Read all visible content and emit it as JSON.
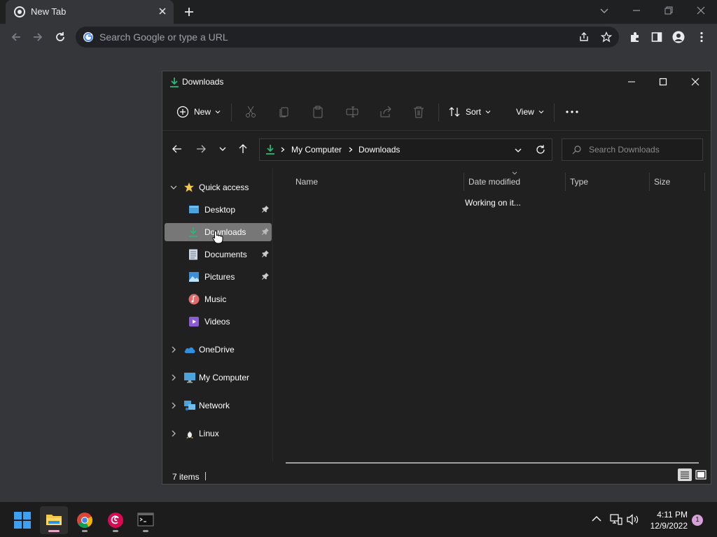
{
  "browser": {
    "tab_title": "New Tab",
    "omnibox_placeholder": "Search Google or type a URL"
  },
  "explorer": {
    "title": "Downloads",
    "commands": {
      "new_label": "New",
      "sort_label": "Sort",
      "view_label": "View"
    },
    "breadcrumb": [
      "My Computer",
      "Downloads"
    ],
    "search_placeholder": "Search Downloads",
    "nav": {
      "quick_access": "Quick access",
      "pinned": [
        {
          "label": "Desktop",
          "icon": "desktop-icon",
          "pinned": true
        },
        {
          "label": "Downloads",
          "icon": "download-arrow-icon",
          "pinned": true,
          "selected": true
        },
        {
          "label": "Documents",
          "icon": "document-icon",
          "pinned": true
        },
        {
          "label": "Pictures",
          "icon": "pictures-icon",
          "pinned": true
        },
        {
          "label": "Music",
          "icon": "music-icon",
          "pinned": false
        },
        {
          "label": "Videos",
          "icon": "videos-icon",
          "pinned": false
        }
      ],
      "roots": [
        {
          "label": "OneDrive",
          "icon": "cloud-icon"
        },
        {
          "label": "My Computer",
          "icon": "computer-icon"
        },
        {
          "label": "Network",
          "icon": "network-icon"
        },
        {
          "label": "Linux",
          "icon": "linux-penguin-icon"
        }
      ]
    },
    "columns": [
      "Name",
      "Date modified",
      "Type",
      "Size"
    ],
    "loading_text": "Working on it...",
    "status": {
      "item_count": "7 items"
    }
  },
  "taskbar": {
    "time": "4:11 PM",
    "date": "12/9/2022",
    "notification_count": "1"
  },
  "colors": {
    "accent_green": "#2bb673",
    "selected_nav": "#777777",
    "folder_yellow": "#f2c94c"
  }
}
